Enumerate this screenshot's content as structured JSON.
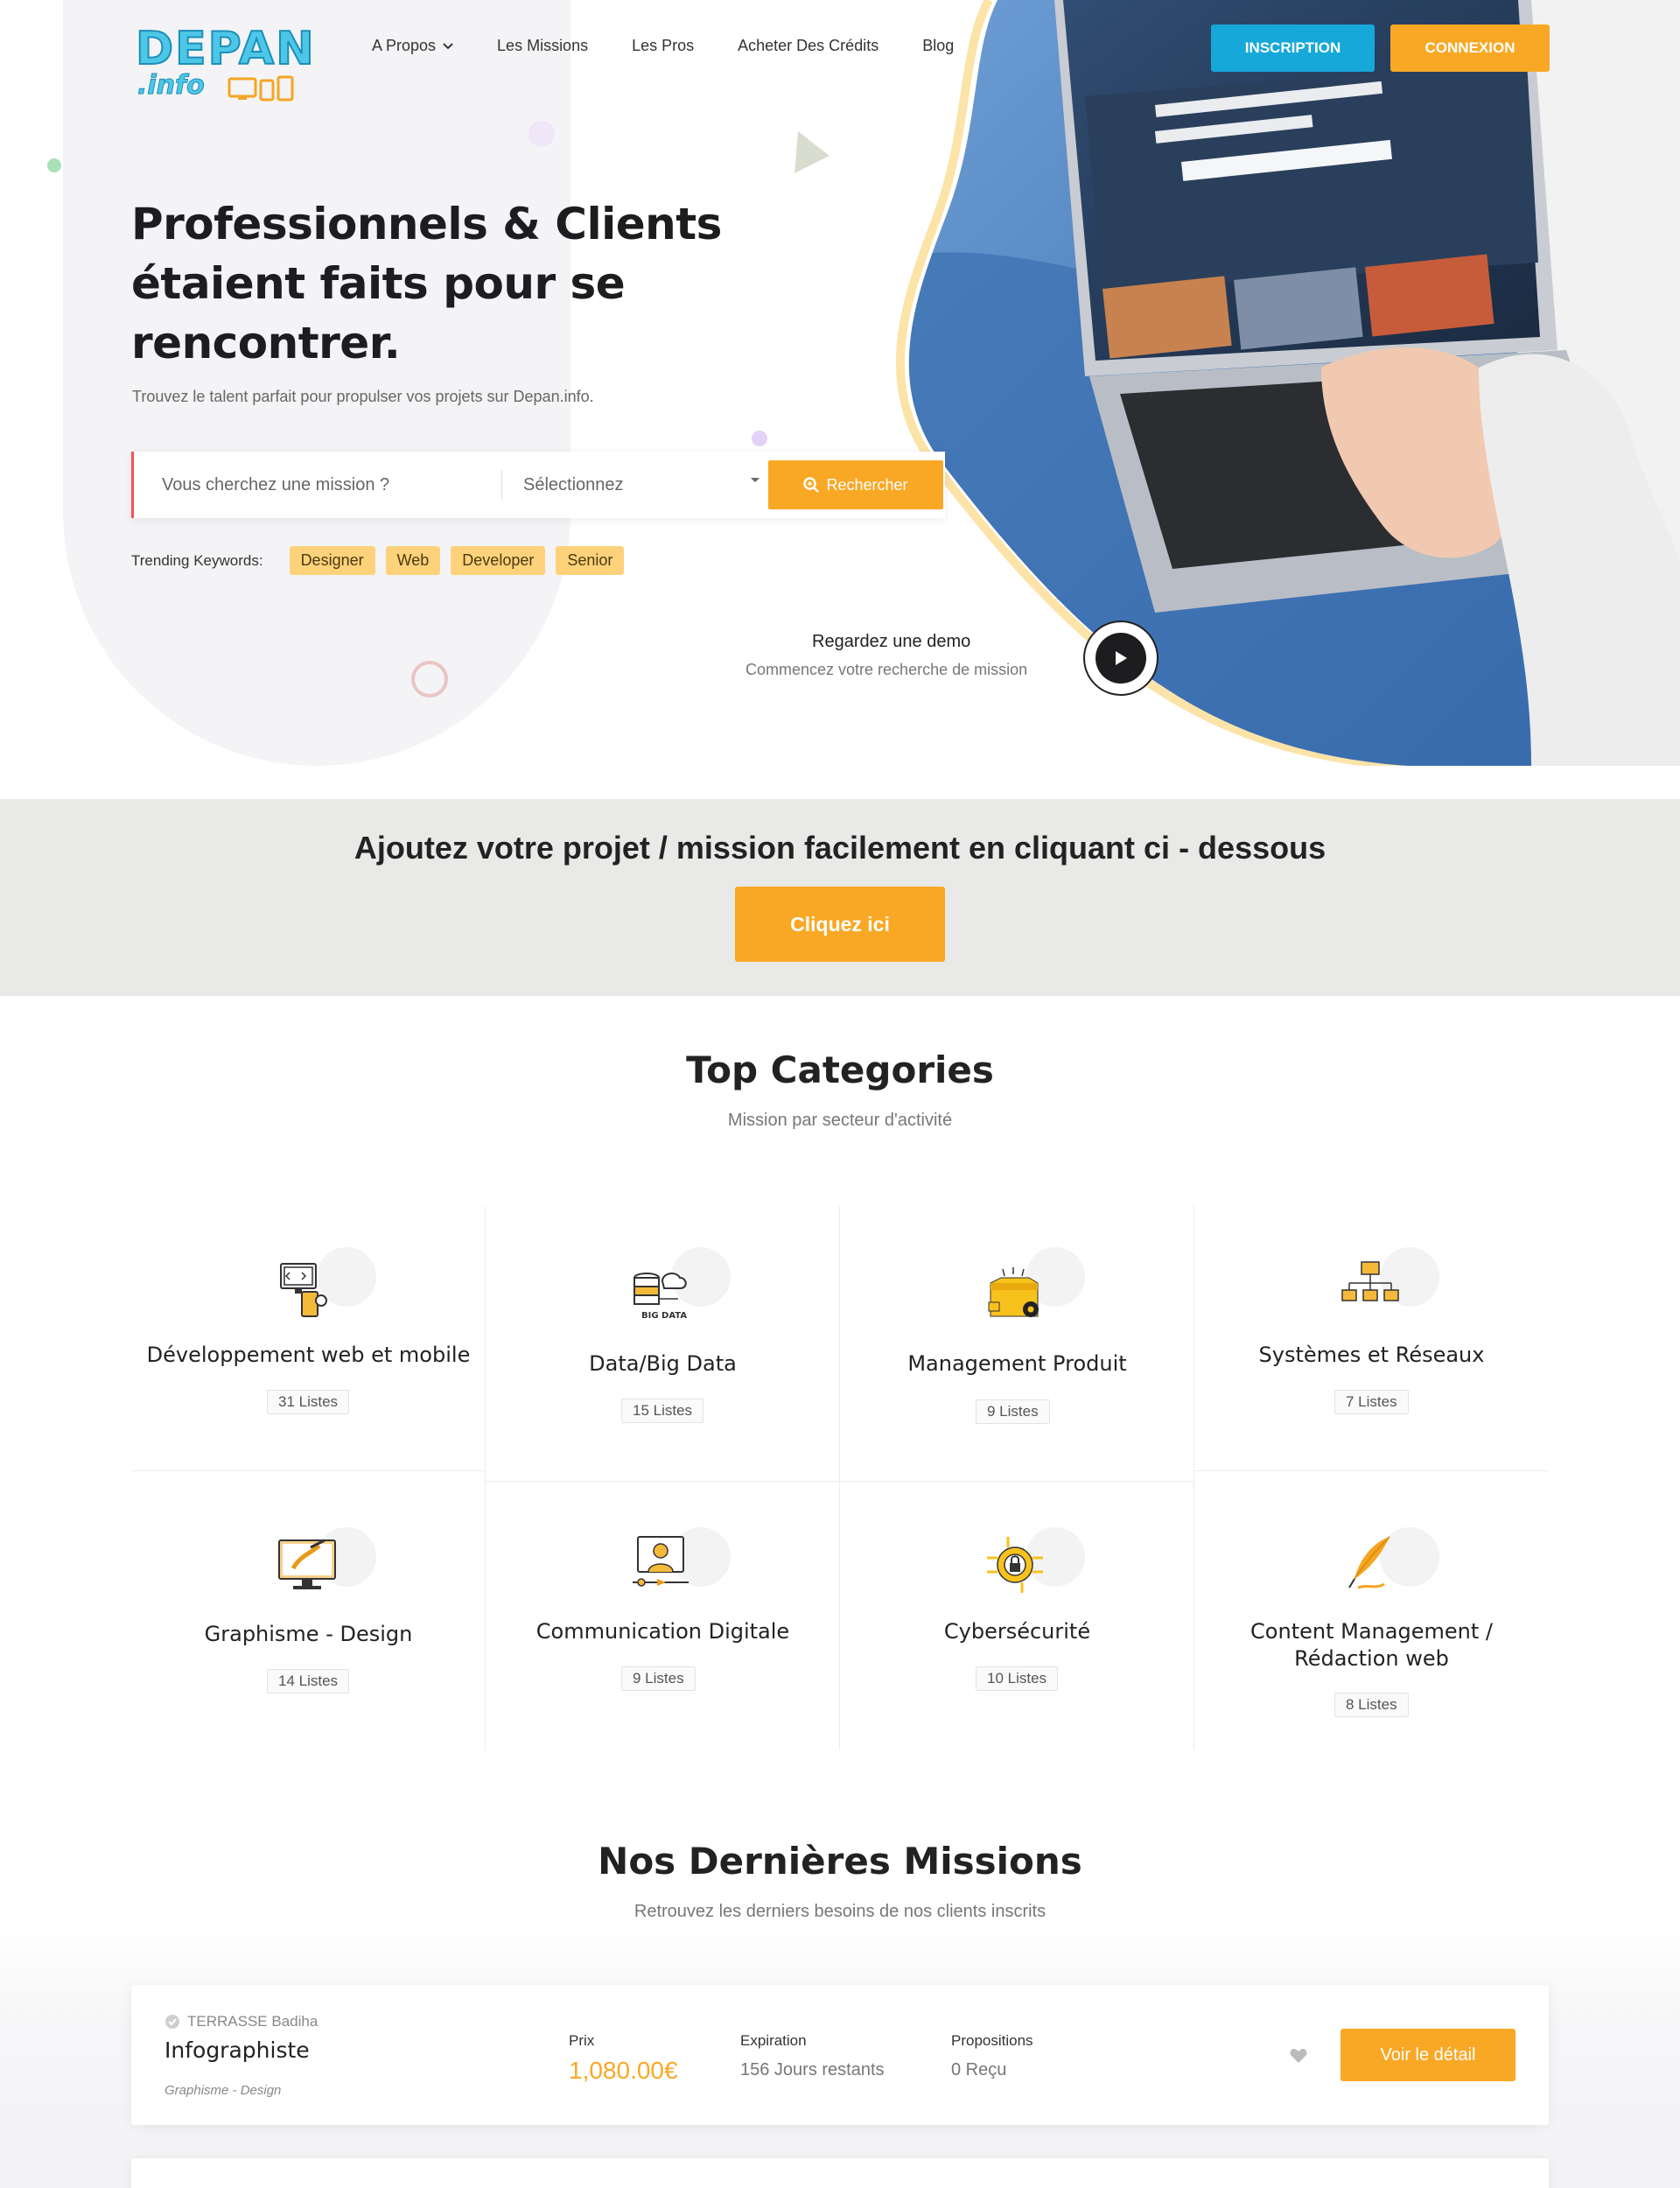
{
  "header": {
    "logo_text": "DEPAN",
    "logo_sub": ".info",
    "nav": [
      {
        "label": "A Propos",
        "has_dropdown": true
      },
      {
        "label": "Les Missions"
      },
      {
        "label": "Les Pros"
      },
      {
        "label": "Acheter Des Crédits"
      },
      {
        "label": "Blog"
      }
    ],
    "inscription_label": "INSCRIPTION",
    "connexion_label": "CONNEXION"
  },
  "hero": {
    "title_line1": "Professionnels & Clients",
    "title_line2": "étaient faits pour se",
    "title_line3": "rencontrer.",
    "subtitle": "Trouvez le talent parfait pour propulser vos projets sur Depan.info.",
    "search_placeholder": "Vous cherchez une mission ?",
    "select_value": "Sélectionnez",
    "search_button": "Rechercher",
    "trending_label": "Trending Keywords:",
    "trending_tags": [
      "Designer",
      "Web",
      "Developer",
      "Senior"
    ],
    "demo_title": "Regardez une demo",
    "demo_sub": "Commencez votre recherche de mission"
  },
  "banner": {
    "title": "Ajoutez votre projet / mission facilement en cliquant ci - dessous",
    "button": "Cliquez ici"
  },
  "categories": {
    "title": "Top Categories",
    "subtitle": "Mission par secteur d'activité",
    "items": [
      {
        "name": "Développement web et mobile",
        "count": "31 Listes",
        "icon": "web-mobile-dev-icon"
      },
      {
        "name": "Data/Big Data",
        "count": "15 Listes",
        "icon": "big-data-icon"
      },
      {
        "name": "Management Produit",
        "count": "9 Listes",
        "icon": "product-box-icon"
      },
      {
        "name": "Systèmes et Réseaux",
        "count": "7 Listes",
        "icon": "network-icon"
      },
      {
        "name": "Graphisme - Design",
        "count": "14 Listes",
        "icon": "graphic-design-icon"
      },
      {
        "name": "Communication Digitale",
        "count": "9 Listes",
        "icon": "digital-communication-icon"
      },
      {
        "name": "Cybersécurité",
        "count": "10 Listes",
        "icon": "cyber-security-icon"
      },
      {
        "name": "Content Management / Rédaction web",
        "name_line1": "Content Management /",
        "name_line2": "Rédaction web",
        "count": "8 Listes",
        "icon": "quill-pen-icon"
      }
    ]
  },
  "missions": {
    "title": "Nos Dernières Missions",
    "subtitle": "Retrouvez les derniers besoins de nos clients inscrits",
    "items": [
      {
        "author": "TERRASSE Badiha",
        "title": "Infographiste",
        "category": "Graphisme - Design",
        "price_label": "Prix",
        "price": "1,080.00€",
        "expiration_label": "Expiration",
        "expiration": "156 Jours restants",
        "proposals_label": "Propositions",
        "proposals": "0 Reçu",
        "button": "Voir le détail"
      }
    ]
  },
  "colors": {
    "accent": "#f9a825",
    "brand_blue": "#16a8d9",
    "tag_bg": "#fdd27a"
  }
}
